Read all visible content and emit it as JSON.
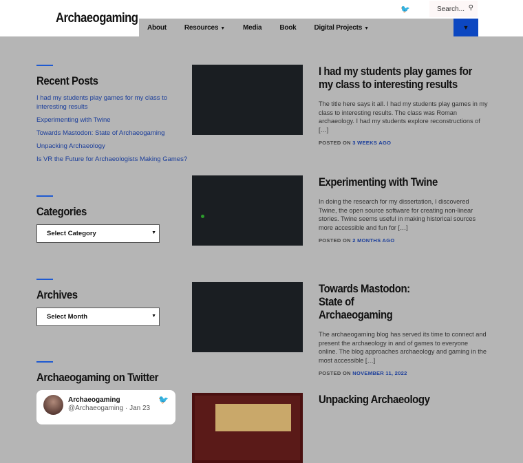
{
  "site": {
    "title": "Archaeogaming"
  },
  "nav": {
    "items": [
      {
        "label": "About"
      },
      {
        "label": "Resources",
        "dropdown": true
      },
      {
        "label": "Media"
      },
      {
        "label": "Book"
      },
      {
        "label": "Digital Projects",
        "dropdown": true
      }
    ],
    "accent": "#0c47c1"
  },
  "search": {
    "placeholder": "Search..."
  },
  "sidebar": {
    "recent": {
      "title": "Recent Posts",
      "items": [
        "I had my students play games for my class to interesting results",
        "Experimenting with Twine",
        "Towards Mastodon: State of Archaeogaming",
        "Unpacking Archaeology",
        "Is VR the Future for Archaeologists Making Games?"
      ]
    },
    "categories": {
      "title": "Categories",
      "select": "Select Category"
    },
    "archives": {
      "title": "Archives",
      "select": "Select Month"
    },
    "twitter": {
      "title": "Archaeogaming on Twitter",
      "name": "Archaeogaming",
      "handle": "@Archaeogaming · Jan 23"
    }
  },
  "posts": [
    {
      "title": "I had my students play games for my class to interesting results",
      "excerpt": "The title here says it all. I had my students play games in my class to interesting results. The class was Roman archaeology. I had my students explore reconstructions of […]",
      "posted_label": "POSTED ON",
      "date": "3 WEEKS AGO"
    },
    {
      "title": "Experimenting with Twine",
      "excerpt": "In doing the research for my dissertation, I discovered Twine, the open source software for creating non-linear stories. Twine seems useful in making historical sources more accessible and fun for […]",
      "posted_label": "POSTED ON",
      "date": "2 MONTHS AGO"
    },
    {
      "title": "Towards Mastodon: State of Archaeogaming",
      "excerpt": "The archaeogaming blog has served its time to connect and present the archaeology in and of games to everyone online. The blog approaches archaeology and gaming in the most accessible […]",
      "posted_label": "POSTED ON",
      "date": "NOVEMBER 11, 2022"
    },
    {
      "title": "Unpacking Archaeology"
    }
  ],
  "colors": {
    "link": "#1a3d9a",
    "overlay": "#b5b5b5",
    "accent_bar": "#1e5ad1"
  }
}
